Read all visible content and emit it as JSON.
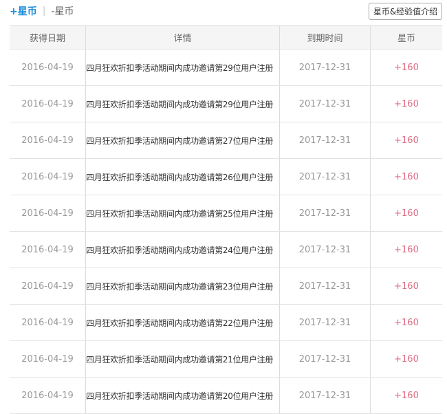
{
  "tabs": {
    "plus_label": "+星币",
    "separator": "|",
    "minus_label": "-星币"
  },
  "intro_button": "星币&经验值介绍",
  "table": {
    "headers": [
      "获得日期",
      "详情",
      "到期时间",
      "星币"
    ],
    "rows": [
      {
        "date": "2016-04-19",
        "detail": "四月狂欢折扣季活动期间内成功邀请第29位用户注册",
        "expiry": "2017-12-31",
        "coins": "+160"
      },
      {
        "date": "2016-04-19",
        "detail": "四月狂欢折扣季活动期间内成功邀请第29位用户注册",
        "expiry": "2017-12-31",
        "coins": "+160"
      },
      {
        "date": "2016-04-19",
        "detail": "四月狂欢折扣季活动期间内成功邀请第27位用户注册",
        "expiry": "2017-12-31",
        "coins": "+160"
      },
      {
        "date": "2016-04-19",
        "detail": "四月狂欢折扣季活动期间内成功邀请第26位用户注册",
        "expiry": "2017-12-31",
        "coins": "+160"
      },
      {
        "date": "2016-04-19",
        "detail": "四月狂欢折扣季活动期间内成功邀请第25位用户注册",
        "expiry": "2017-12-31",
        "coins": "+160"
      },
      {
        "date": "2016-04-19",
        "detail": "四月狂欢折扣季活动期间内成功邀请第24位用户注册",
        "expiry": "2017-12-31",
        "coins": "+160"
      },
      {
        "date": "2016-04-19",
        "detail": "四月狂欢折扣季活动期间内成功邀请第23位用户注册",
        "expiry": "2017-12-31",
        "coins": "+160"
      },
      {
        "date": "2016-04-19",
        "detail": "四月狂欢折扣季活动期间内成功邀请第22位用户注册",
        "expiry": "2017-12-31",
        "coins": "+160"
      },
      {
        "date": "2016-04-19",
        "detail": "四月狂欢折扣季活动期间内成功邀请第21位用户注册",
        "expiry": "2017-12-31",
        "coins": "+160"
      },
      {
        "date": "2016-04-19",
        "detail": "四月狂欢折扣季活动期间内成功邀请第20位用户注册",
        "expiry": "2017-12-31",
        "coins": "+160"
      }
    ]
  },
  "colors": {
    "accent": "#1a8bd8",
    "coins": "#e06b82",
    "header_bg": "#f5f5f5"
  }
}
